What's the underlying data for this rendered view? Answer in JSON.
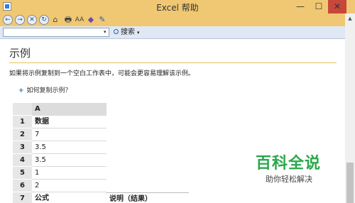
{
  "window": {
    "title": "Excel 帮助",
    "minimize": "—",
    "maximize": "☐",
    "close": "✕"
  },
  "toolbar": {
    "back": "←",
    "forward": "→",
    "stop": "✕",
    "refresh": "↻",
    "home": "⌂",
    "print": "🖶",
    "font_size": "AA",
    "keep_on_top": "◆",
    "toc": "✎"
  },
  "search": {
    "value": "",
    "dropdown": "▾",
    "button_label": "搜索",
    "button_dropdown": "▾"
  },
  "content": {
    "title": "示例",
    "intro": "如果将示例复制到一个空白工作表中，可能会更容易理解该示例。",
    "howto_plus": "+",
    "howto_label": "如何复制示例？"
  },
  "sheet": {
    "column_header": "A",
    "rows": [
      {
        "num": "1",
        "a": "数据"
      },
      {
        "num": "2",
        "a": "7"
      },
      {
        "num": "3",
        "a": "3.5"
      },
      {
        "num": "4",
        "a": "3.5"
      },
      {
        "num": "5",
        "a": "1"
      },
      {
        "num": "6",
        "a": "2"
      },
      {
        "num": "7",
        "a": "公式",
        "b": "说明（结果）"
      }
    ]
  },
  "watermark": {
    "main": "百科全说",
    "sub": "助你轻松解决"
  },
  "colors": {
    "titlebar": "#f0c873",
    "close": "#c7473a",
    "rule": "#e7c560",
    "watermark": "#2aa84a"
  }
}
